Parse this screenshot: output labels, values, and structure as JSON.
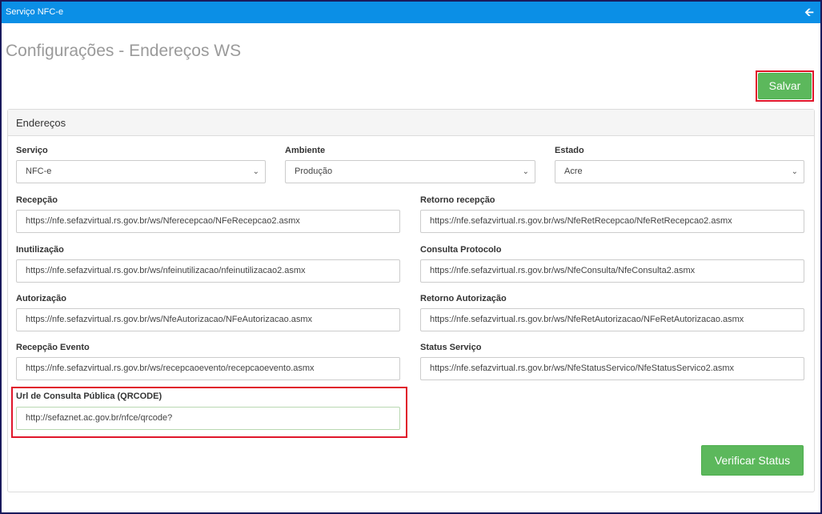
{
  "window": {
    "title": "Serviço NFC-e",
    "back_icon": "arrow-left-icon"
  },
  "page": {
    "title": "Configurações - Endereços WS"
  },
  "toolbar": {
    "save_label": "Salvar"
  },
  "panel": {
    "title": "Endereços"
  },
  "selects": {
    "servico": {
      "label": "Serviço",
      "value": "NFC-e"
    },
    "ambiente": {
      "label": "Ambiente",
      "value": "Produção"
    },
    "estado": {
      "label": "Estado",
      "value": "Acre"
    }
  },
  "fields": {
    "recepcao": {
      "label": "Recepção",
      "value": "https://nfe.sefazvirtual.rs.gov.br/ws/Nferecepcao/NFeRecepcao2.asmx"
    },
    "retorno_recepcao": {
      "label": "Retorno recepção",
      "value": "https://nfe.sefazvirtual.rs.gov.br/ws/NfeRetRecepcao/NfeRetRecepcao2.asmx"
    },
    "inutilizacao": {
      "label": "Inutilização",
      "value": "https://nfe.sefazvirtual.rs.gov.br/ws/nfeinutilizacao/nfeinutilizacao2.asmx"
    },
    "consulta_protocolo": {
      "label": "Consulta Protocolo",
      "value": "https://nfe.sefazvirtual.rs.gov.br/ws/NfeConsulta/NfeConsulta2.asmx"
    },
    "autorizacao": {
      "label": "Autorização",
      "value": "https://nfe.sefazvirtual.rs.gov.br/ws/NfeAutorizacao/NFeAutorizacao.asmx"
    },
    "retorno_autorizacao": {
      "label": "Retorno Autorização",
      "value": "https://nfe.sefazvirtual.rs.gov.br/ws/NfeRetAutorizacao/NFeRetAutorizacao.asmx"
    },
    "recepcao_evento": {
      "label": "Recepção Evento",
      "value": "https://nfe.sefazvirtual.rs.gov.br/ws/recepcaoevento/recepcaoevento.asmx"
    },
    "status_servico": {
      "label": "Status Serviço",
      "value": "https://nfe.sefazvirtual.rs.gov.br/ws/NfeStatusServico/NfeStatusServico2.asmx"
    },
    "url_qrcode": {
      "label": "Url de Consulta Pública (QRCODE)",
      "value": "http://sefaznet.ac.gov.br/nfce/qrcode?"
    }
  },
  "actions": {
    "verify_label": "Verificar Status"
  },
  "colors": {
    "topbar": "#0b8fe6",
    "button": "#5cb85c",
    "highlight": "#e0162a"
  }
}
